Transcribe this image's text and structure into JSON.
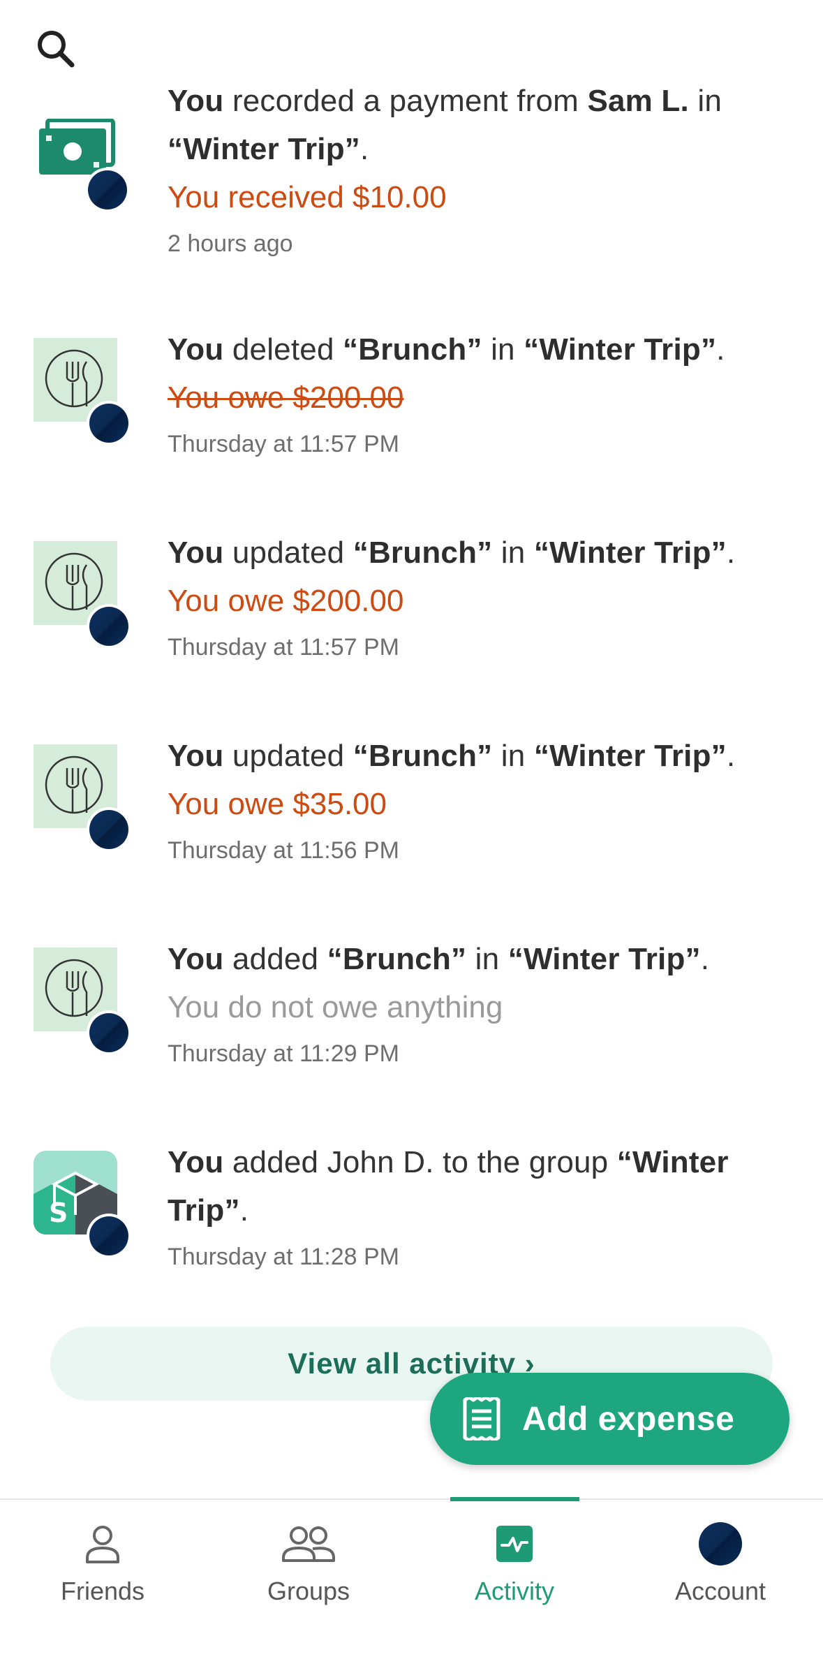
{
  "search": {
    "icon": "search-icon"
  },
  "activities": [
    {
      "type": "payment",
      "line1": [
        {
          "t": "You",
          "b": true
        },
        {
          "t": " recorded a payment from ",
          "b": false
        },
        {
          "t": "Sam L.",
          "b": true
        },
        {
          "t": " in ",
          "b": false
        }
      ],
      "line2": [
        {
          "t": "“Winter Trip”",
          "b": true
        },
        {
          "t": ".",
          "b": false
        }
      ],
      "amount": "You received $10.00",
      "timestamp": "2 hours ago"
    },
    {
      "type": "food",
      "line1": [
        {
          "t": "You",
          "b": true
        },
        {
          "t": " deleted ",
          "b": false
        },
        {
          "t": "“Brunch”",
          "b": true
        },
        {
          "t": " in ",
          "b": false
        },
        {
          "t": "“Winter Trip”",
          "b": true
        },
        {
          "t": ".",
          "b": false
        }
      ],
      "amount": "You owe $200.00",
      "amount_style": "strike",
      "timestamp": "Thursday at 11:57 PM"
    },
    {
      "type": "food",
      "line1": [
        {
          "t": "You",
          "b": true
        },
        {
          "t": " updated ",
          "b": false
        },
        {
          "t": "“Brunch”",
          "b": true
        },
        {
          "t": " in ",
          "b": false
        },
        {
          "t": "“Winter Trip”",
          "b": true
        },
        {
          "t": ".",
          "b": false
        }
      ],
      "amount": "You owe $200.00",
      "timestamp": "Thursday at 11:57 PM"
    },
    {
      "type": "food",
      "line1": [
        {
          "t": "You",
          "b": true
        },
        {
          "t": " updated ",
          "b": false
        },
        {
          "t": "“Brunch”",
          "b": true
        },
        {
          "t": " in ",
          "b": false
        },
        {
          "t": "“Winter Trip”",
          "b": true
        },
        {
          "t": ".",
          "b": false
        }
      ],
      "amount": "You owe $35.00",
      "timestamp": "Thursday at 11:56 PM"
    },
    {
      "type": "food",
      "line1": [
        {
          "t": "You",
          "b": true
        },
        {
          "t": " added ",
          "b": false
        },
        {
          "t": "“Brunch”",
          "b": true
        },
        {
          "t": " in ",
          "b": false
        },
        {
          "t": "“Winter Trip”",
          "b": true
        },
        {
          "t": ".",
          "b": false
        }
      ],
      "amount": "You do not owe anything",
      "amount_style": "gray",
      "timestamp": "Thursday at 11:29 PM"
    },
    {
      "type": "group",
      "line1": [
        {
          "t": "You",
          "b": true
        },
        {
          "t": " added John D. to the group ",
          "b": false
        },
        {
          "t": "“Winter",
          "b": true
        }
      ],
      "line2": [
        {
          "t": "Trip”",
          "b": true
        },
        {
          "t": ".",
          "b": false
        }
      ],
      "timestamp": "Thursday at 11:28 PM"
    }
  ],
  "view_all": {
    "label": "View all activity ›"
  },
  "add_expense": {
    "label": "Add expense",
    "icon": "receipt-icon"
  },
  "tabs": [
    {
      "label": "Friends",
      "icon": "person-icon",
      "active": false
    },
    {
      "label": "Groups",
      "icon": "group-icon",
      "active": false
    },
    {
      "label": "Activity",
      "icon": "activity-icon",
      "active": true
    },
    {
      "label": "Account",
      "icon": "avatar",
      "active": false
    }
  ],
  "colors": {
    "accent": "#1ea67f",
    "owe": "#cc4b12",
    "tile": "#d6ecdb"
  }
}
